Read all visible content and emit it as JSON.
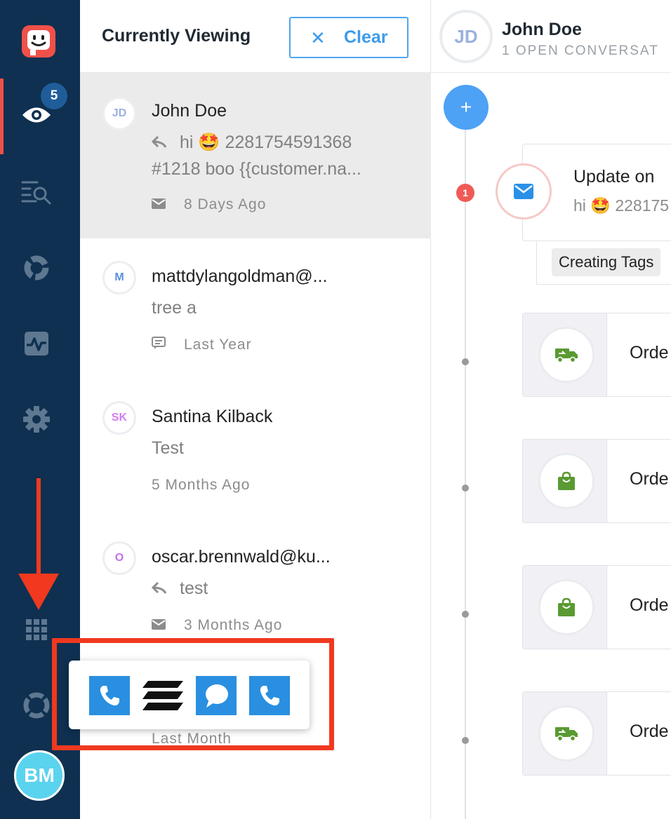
{
  "colors": {
    "rail_bg": "#0f3050",
    "active_indicator": "#f0504a",
    "accent_blue": "#3d9be9",
    "selected_row": "#ebebeb",
    "highlight_red": "#f0391f",
    "order_icon_green": "#5a9a32"
  },
  "nav": {
    "logo_icon": "robot-face-icon",
    "items": [
      {
        "name": "eye-icon",
        "active": true
      },
      {
        "name": "search-list-icon"
      },
      {
        "name": "donut-chart-icon"
      },
      {
        "name": "activity-icon"
      },
      {
        "name": "gear-icon"
      },
      {
        "name": "apps-grid-icon"
      },
      {
        "name": "lifebuoy-icon"
      }
    ],
    "badge_count": "5",
    "user_initials": "BM"
  },
  "list": {
    "title": "Currently Viewing",
    "clear_label": "Clear",
    "conversations": [
      {
        "initials": "JD",
        "initials_color": "#9ab0de",
        "name": "John Doe",
        "preview_line1": "hi 🤩 2281754591368",
        "preview_line2": "#1218 boo {{customer.na...",
        "has_reply_icon": true,
        "channel_icon": "mail-icon",
        "time": "8 Days Ago"
      },
      {
        "initials": "M",
        "initials_color": "#5a8fe0",
        "name": "mattdylangoldman@...",
        "preview_line1": "tree a",
        "has_reply_icon": false,
        "channel_icon": "chat-icon",
        "time": "Last Year"
      },
      {
        "initials": "SK",
        "initials_color": "#d27ef0",
        "name": "Santina Kilback",
        "preview_line1": "Test",
        "has_reply_icon": false,
        "channel_icon": "",
        "time": "5 Months Ago"
      },
      {
        "initials": "O",
        "initials_color": "#c470e8",
        "name": "oscar.brennwald@ku...",
        "preview_line1": "test",
        "has_reply_icon": true,
        "channel_icon": "mail-icon",
        "time": "3 Months Ago"
      }
    ],
    "partial_time": "Last Month"
  },
  "popup": {
    "apps": [
      "phone-app-icon",
      "stripes-app-icon",
      "chat-bubble-app-icon",
      "phone-app-icon"
    ]
  },
  "detail": {
    "initials": "JD",
    "name": "John Doe",
    "subtitle": "1 OPEN CONVERSAT",
    "plus_label": "+",
    "unread_count": "1",
    "email_title": "Update on",
    "email_preview": "hi 🤩 228175",
    "tag": "Creating Tags",
    "orders": [
      {
        "icon": "delivery-truck-icon",
        "label": "Orde"
      },
      {
        "icon": "shopping-bag-icon",
        "label": "Orde"
      },
      {
        "icon": "shopping-bag-icon",
        "label": "Orde"
      },
      {
        "icon": "delivery-truck-icon",
        "label": "Orde"
      }
    ]
  }
}
